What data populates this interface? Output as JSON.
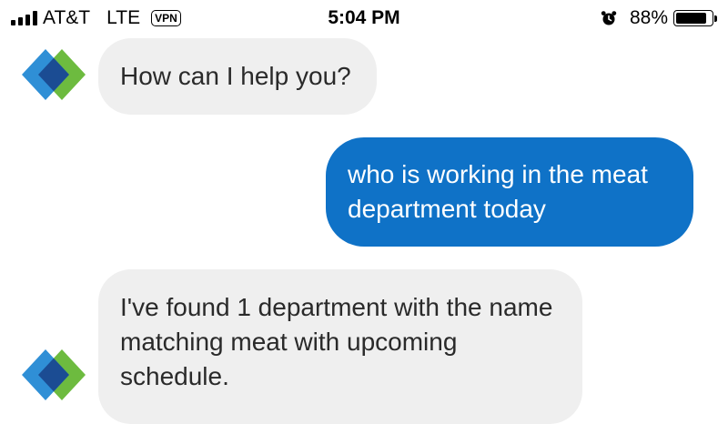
{
  "status_bar": {
    "carrier": "AT&T",
    "network": "LTE",
    "vpn": "VPN",
    "time": "5:04 PM",
    "battery_percent_text": "88%",
    "battery_level": 0.88,
    "signal_bars": 4,
    "icons": [
      "signal-icon",
      "alarm-icon",
      "battery-icon"
    ]
  },
  "chat": {
    "messages": [
      {
        "sender": "bot",
        "text": "How can I help you?"
      },
      {
        "sender": "user",
        "text": "who is working in the meat department today"
      },
      {
        "sender": "bot",
        "text": "I've found 1 department with the name matching meat with upcoming schedule."
      }
    ],
    "avatar_icon": "bot-diamond-logo-icon"
  },
  "colors": {
    "outgoing_bubble": "#0f72c7",
    "incoming_bubble": "#efefef",
    "logo_blue_light": "#2f8fd6",
    "logo_blue_dark": "#1b4c93",
    "logo_green": "#6dbb3f"
  }
}
